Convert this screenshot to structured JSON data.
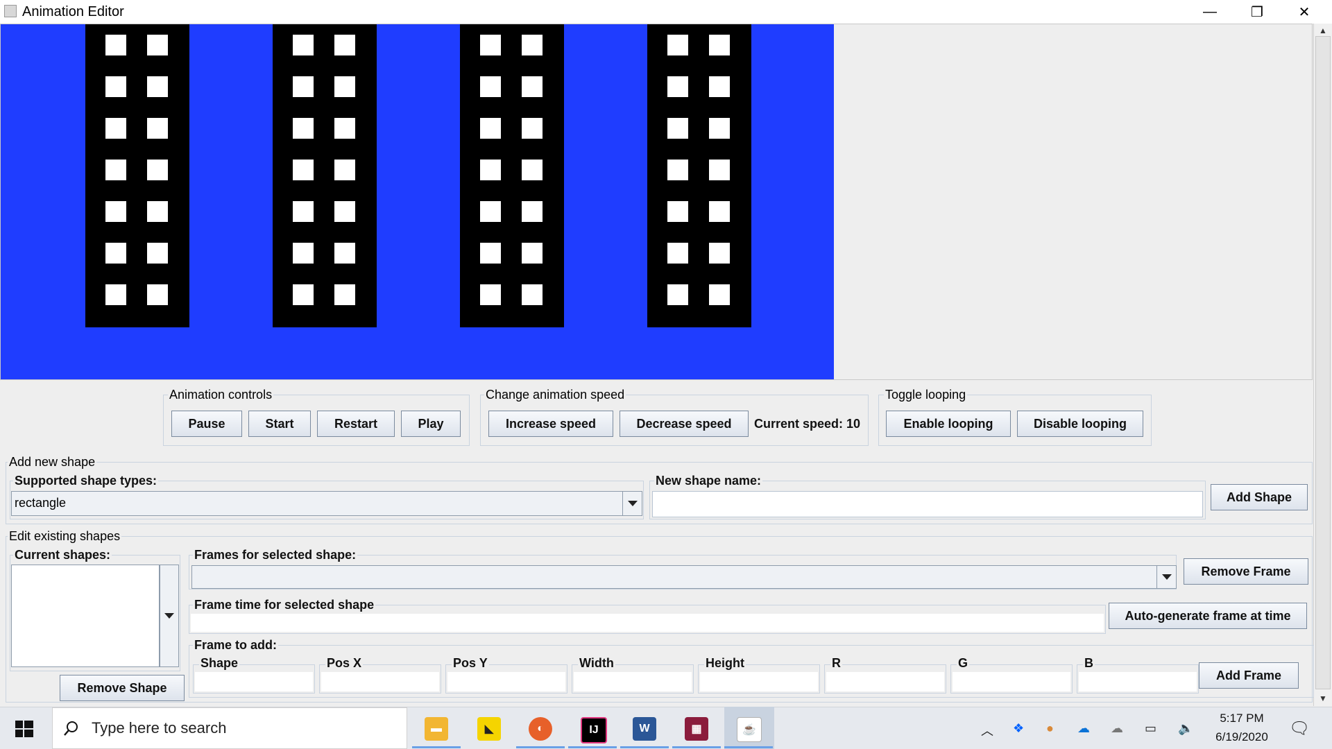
{
  "window": {
    "title": "Animation Editor",
    "minimize_glyph": "—",
    "restore_glyph": "❐",
    "close_glyph": "✕"
  },
  "canvas": {
    "background": "#1f3dff",
    "building_color": "#000000",
    "window_color": "#ffffff",
    "building_count": 4,
    "window_rows": 7,
    "window_columns": 2
  },
  "animation_controls": {
    "title": "Animation controls",
    "pause": "Pause",
    "start": "Start",
    "restart": "Restart",
    "play": "Play"
  },
  "speed": {
    "title": "Change animation speed",
    "increase": "Increase speed",
    "decrease": "Decrease speed",
    "current": "Current speed: 10"
  },
  "looping": {
    "title": "Toggle looping",
    "enable": "Enable looping",
    "disable": "Disable looping"
  },
  "add_shape": {
    "title": "Add new shape",
    "types_label": "Supported shape types:",
    "selected_type": "rectangle",
    "name_label": "New shape name:",
    "name_value": "",
    "add_button": "Add Shape"
  },
  "edit_shapes": {
    "title": "Edit existing shapes",
    "current_label": "Current shapes:",
    "frames_label": "Frames for selected shape:",
    "remove_frame": "Remove Frame",
    "frame_time_label": "Frame time for selected shape",
    "auto_generate": "Auto-generate frame at time",
    "frame_to_add_label": "Frame to add:",
    "fields": [
      "Shape",
      "Pos X",
      "Pos Y",
      "Width",
      "Height",
      "R",
      "G",
      "B"
    ],
    "add_frame": "Add Frame",
    "remove_shape": "Remove Shape"
  },
  "taskbar": {
    "search_placeholder": "Type here to search",
    "time": "5:17 PM",
    "date": "6/19/2020",
    "apps": [
      "file-explorer-icon",
      "sticky-notes-icon",
      "firefox-icon",
      "intellij-icon",
      "word-icon",
      "winrar-icon",
      "java-icon"
    ]
  }
}
